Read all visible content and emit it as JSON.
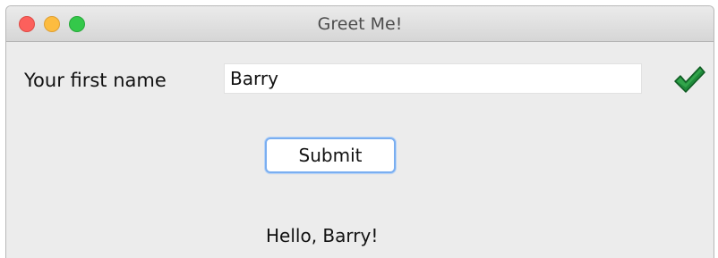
{
  "window": {
    "title": "Greet Me!"
  },
  "form": {
    "name_label": "Your first name",
    "name_value": "Barry",
    "submit_label": "Submit",
    "greeting": "Hello, Barry!"
  },
  "icons": {
    "validation": "check-icon"
  },
  "colors": {
    "check": "#1f8a3a",
    "button_border": "#7aaef0"
  }
}
